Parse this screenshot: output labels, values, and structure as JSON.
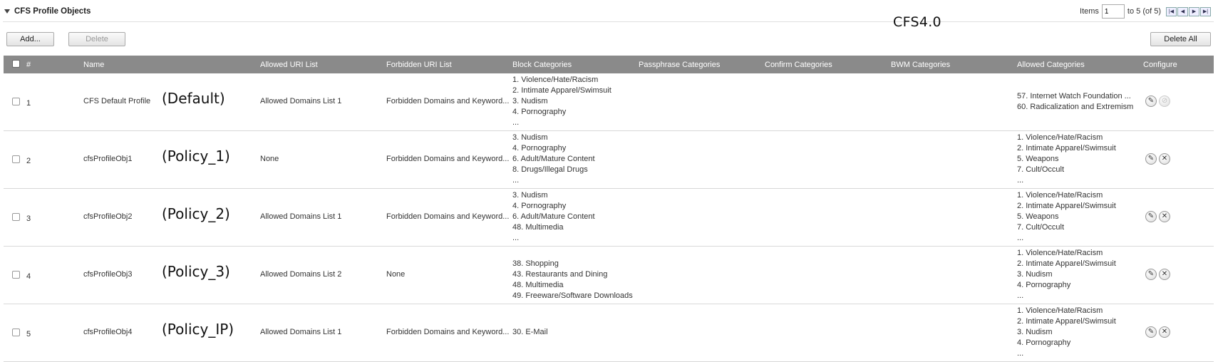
{
  "section": {
    "title": "CFS Profile Objects"
  },
  "pager": {
    "label": "Items",
    "value": "1",
    "range_text": "to 5 (of 5)"
  },
  "version_label": "CFS4.0",
  "toolbar": {
    "add_label": "Add...",
    "delete_label": "Delete",
    "delete_all_label": "Delete All"
  },
  "columns": {
    "num": "#",
    "name": "Name",
    "allowed_uri": "Allowed URI List",
    "forbidden_uri": "Forbidden URI List",
    "block": "Block Categories",
    "passphrase": "Passphrase Categories",
    "confirm": "Confirm Categories",
    "bwm": "BWM Categories",
    "allowed_cat": "Allowed Categories",
    "configure": "Configure"
  },
  "rows": [
    {
      "num": "1",
      "name": "CFS Default Profile",
      "annotation": "(Default)",
      "allowed_uri": "Allowed Domains List 1",
      "forbidden_uri": "Forbidden Domains and Keyword...",
      "block": [
        "1. Violence/Hate/Racism",
        "2. Intimate Apparel/Swimsuit",
        "3. Nudism",
        "4. Pornography",
        "..."
      ],
      "allowed_cat": [
        "57. Internet Watch Foundation ...",
        "60. Radicalization and Extremism"
      ],
      "delete_disabled": true
    },
    {
      "num": "2",
      "name": "cfsProfileObj1",
      "annotation": "(Policy_1)",
      "allowed_uri": "None",
      "forbidden_uri": "Forbidden Domains and Keyword...",
      "block": [
        "3. Nudism",
        "4. Pornography",
        "6. Adult/Mature Content",
        "8. Drugs/Illegal Drugs",
        "..."
      ],
      "allowed_cat": [
        "1. Violence/Hate/Racism",
        "2. Intimate Apparel/Swimsuit",
        "5. Weapons",
        "7. Cult/Occult",
        "..."
      ],
      "delete_disabled": false
    },
    {
      "num": "3",
      "name": "cfsProfileObj2",
      "annotation": "(Policy_2)",
      "allowed_uri": "Allowed Domains List 1",
      "forbidden_uri": "Forbidden Domains and Keyword...",
      "block": [
        "3. Nudism",
        "4. Pornography",
        "6. Adult/Mature Content",
        "48. Multimedia",
        "..."
      ],
      "allowed_cat": [
        "1. Violence/Hate/Racism",
        "2. Intimate Apparel/Swimsuit",
        "5. Weapons",
        "7. Cult/Occult",
        "..."
      ],
      "delete_disabled": false
    },
    {
      "num": "4",
      "name": "cfsProfileObj3",
      "annotation": "(Policy_3)",
      "allowed_uri": "Allowed Domains List 2",
      "forbidden_uri": "None",
      "block": [
        "",
        "38. Shopping",
        "43. Restaurants and Dining",
        "48. Multimedia",
        "49. Freeware/Software Downloads"
      ],
      "allowed_cat": [
        "1. Violence/Hate/Racism",
        "2. Intimate Apparel/Swimsuit",
        "3. Nudism",
        "4. Pornography",
        "..."
      ],
      "delete_disabled": false
    },
    {
      "num": "5",
      "name": "cfsProfileObj4",
      "annotation": "(Policy_IP)",
      "allowed_uri": "Allowed Domains List 1",
      "forbidden_uri": "Forbidden Domains and Keyword...",
      "block": [
        "",
        "",
        "30. E-Mail"
      ],
      "allowed_cat": [
        "1. Violence/Hate/Racism",
        "2. Intimate Apparel/Swimsuit",
        "3. Nudism",
        "4. Pornography",
        "..."
      ],
      "delete_disabled": false
    }
  ]
}
